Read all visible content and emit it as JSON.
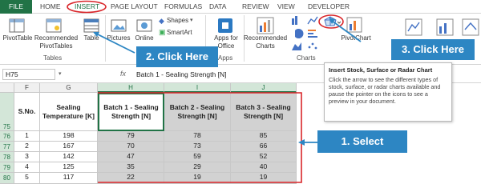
{
  "tabs": [
    "FILE",
    "HOME",
    "INSERT",
    "PAGE LAYOUT",
    "FORMULAS",
    "DATA",
    "REVIEW",
    "VIEW",
    "DEVELOPER"
  ],
  "ribbon": {
    "pivottable": "PivotTable",
    "recommended_pivottables": "Recommended PivotTables",
    "table": "Table",
    "pictures": "Pictures",
    "online": "Online",
    "shapes": "Shapes",
    "smartart": "SmartArt",
    "apps_for_office": "Apps for Office",
    "recommended_charts": "Recommended Charts",
    "pivotchart": "PivotChart",
    "group_tables": "Tables",
    "group_apps": "Apps",
    "group_charts": "Charts"
  },
  "formula_bar": {
    "name_box": "H75",
    "content": "Batch 1 - Sealing Strength [N]"
  },
  "columns": [
    "F",
    "G",
    "H",
    "I",
    "J"
  ],
  "rows": [
    "75",
    "76",
    "77",
    "78",
    "79",
    "80"
  ],
  "table": {
    "headers": [
      "S.No.",
      "Sealing Temperature [K]",
      "Batch 1 - Sealing Strength [N]",
      "Batch 2 - Sealing Strength [N]",
      "Batch 3 - Sealing Strength [N]"
    ],
    "data": [
      [
        "1",
        "198",
        "79",
        "78",
        "85"
      ],
      [
        "2",
        "167",
        "70",
        "73",
        "66"
      ],
      [
        "3",
        "142",
        "47",
        "59",
        "52"
      ],
      [
        "4",
        "125",
        "35",
        "29",
        "40"
      ],
      [
        "5",
        "117",
        "22",
        "19",
        "19"
      ]
    ]
  },
  "annotations": {
    "step1": "1. Select",
    "step2": "2. Click Here",
    "step3": "3. Click Here"
  },
  "tooltip": {
    "title": "Insert Stock, Surface or Radar Chart",
    "body": "Click the arrow to see the different types of stock, surface, or radar charts available and pause the pointer on the icons to see a preview in your document."
  },
  "colors": {
    "excel_green": "#217346",
    "annotation_red": "#d9262a",
    "callout_blue": "#2d86c3",
    "shade_gray": "#d2d2d2"
  }
}
